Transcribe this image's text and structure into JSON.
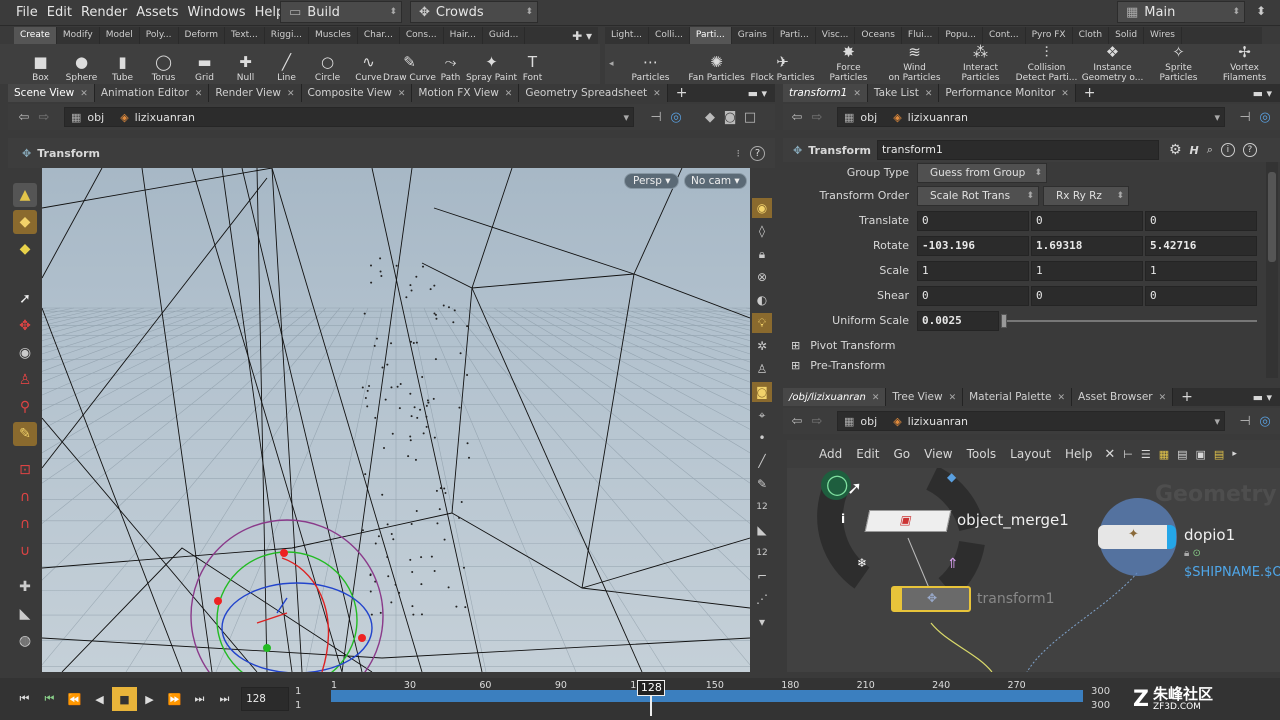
{
  "menubar": {
    "items": [
      "File",
      "Edit",
      "Render",
      "Assets",
      "Windows",
      "Help"
    ],
    "desktop": "Build",
    "context": "Crowds",
    "main": "Main"
  },
  "shelf_tabs_left": [
    "Create",
    "Modify",
    "Model",
    "Poly...",
    "Deform",
    "Text...",
    "Riggi...",
    "Muscles",
    "Char...",
    "Cons...",
    "Hair...",
    "Guid..."
  ],
  "shelf_tabs_right": [
    "Light...",
    "Colli...",
    "Parti...",
    "Grains",
    "Parti...",
    "Visc...",
    "Oceans",
    "Flui...",
    "Popu...",
    "Cont...",
    "Pyro FX",
    "Cloth",
    "Solid",
    "Wires"
  ],
  "shelf_tools_left": [
    {
      "label": "Box",
      "icon": "box-icon",
      "glyph": "■"
    },
    {
      "label": "Sphere",
      "icon": "sphere-icon",
      "glyph": "●"
    },
    {
      "label": "Tube",
      "icon": "tube-icon",
      "glyph": "▮"
    },
    {
      "label": "Torus",
      "icon": "torus-icon",
      "glyph": "◯"
    },
    {
      "label": "Grid",
      "icon": "grid-icon",
      "glyph": "▬"
    },
    {
      "label": "Null",
      "icon": "null-icon",
      "glyph": "✚"
    },
    {
      "label": "Line",
      "icon": "line-icon",
      "glyph": "╱"
    },
    {
      "label": "Circle",
      "icon": "circle-icon",
      "glyph": "○"
    },
    {
      "label": "Curve",
      "icon": "curve-icon",
      "glyph": "∿"
    },
    {
      "label": "Draw Curve",
      "icon": "draw-curve-icon",
      "glyph": "✎"
    },
    {
      "label": "Path",
      "icon": "path-icon",
      "glyph": "⤳"
    },
    {
      "label": "Spray Paint",
      "icon": "spray-paint-icon",
      "glyph": "✦"
    },
    {
      "label": "Font",
      "icon": "font-icon",
      "glyph": "T"
    }
  ],
  "shelf_tools_right": [
    {
      "label": "Particles",
      "icon": "particles-icon",
      "glyph": "⋯"
    },
    {
      "label": "Fan Particles",
      "icon": "fan-particles-icon",
      "glyph": "✺"
    },
    {
      "label": "Flock Particles",
      "icon": "flock-particles-icon",
      "glyph": "✈"
    },
    {
      "label": "Force\nParticles",
      "icon": "force-particles-icon",
      "glyph": "✸"
    },
    {
      "label": "Wind\non Particles",
      "icon": "wind-icon",
      "glyph": "≋"
    },
    {
      "label": "Interact\nParticles",
      "icon": "interact-icon",
      "glyph": "⁂"
    },
    {
      "label": "Collision\nDetect Parti...",
      "icon": "collision-icon",
      "glyph": "⫶"
    },
    {
      "label": "Instance\nGeometry o...",
      "icon": "instance-icon",
      "glyph": "❖"
    },
    {
      "label": "Sprite\nParticles",
      "icon": "sprite-icon",
      "glyph": "✧"
    },
    {
      "label": "Vortex\nFilaments",
      "icon": "vortex-icon",
      "glyph": "✢"
    }
  ],
  "left_pane": {
    "tabs": [
      "Scene View",
      "Animation Editor",
      "Render View",
      "Composite View",
      "Motion FX View",
      "Geometry Spreadsheet"
    ],
    "path": [
      "obj",
      "lizixuanran"
    ],
    "tool_title": "Transform",
    "persp": "Persp",
    "cam": "No cam"
  },
  "params_pane": {
    "tabs": [
      "transform1",
      "Take List",
      "Performance Monitor"
    ],
    "path": [
      "obj",
      "lizixuanran"
    ],
    "node_type": "Transform",
    "node_name": "transform1",
    "group_type_label": "Group Type",
    "group_type": "Guess from Group",
    "transform_order_label": "Transform Order",
    "transform_order": "Scale Rot Trans",
    "rot_order": "Rx Ry Rz",
    "translate_label": "Translate",
    "translate": [
      "0",
      "0",
      "0"
    ],
    "rotate_label": "Rotate",
    "rotate": [
      "-103.196",
      "1.69318",
      "5.42716"
    ],
    "scale_label": "Scale",
    "scale": [
      "1",
      "1",
      "1"
    ],
    "shear_label": "Shear",
    "shear": [
      "0",
      "0",
      "0"
    ],
    "uniform_scale_label": "Uniform Scale",
    "uniform_scale": "0.0025",
    "uniform_scale_slider": 0.0025,
    "pivot_transform": "Pivot Transform",
    "pre_transform": "Pre-Transform"
  },
  "network_pane": {
    "tabs": [
      "/obj/lizixuanran",
      "Tree View",
      "Material Palette",
      "Asset Browser"
    ],
    "path": [
      "obj",
      "lizixuanran"
    ],
    "menu": [
      "Add",
      "Edit",
      "Go",
      "View",
      "Tools",
      "Layout",
      "Help"
    ],
    "watermark": "Geometry",
    "node_merge": "object_merge1",
    "node_dopio": "dopio1",
    "node_dopio_param": "$SHIPNAME.$OS",
    "node_transform": "transform1"
  },
  "timeline": {
    "frame_field": "128",
    "start_top": "1",
    "start_bottom": "1",
    "ticks": [
      "1",
      "30",
      "60",
      "90",
      "120",
      "150",
      "180",
      "210",
      "240",
      "270"
    ],
    "current_frame": "128",
    "end_top": "300",
    "end_bottom": "300"
  },
  "logo": {
    "text": "朱峰社区",
    "sub": "ZF3D.COM"
  }
}
